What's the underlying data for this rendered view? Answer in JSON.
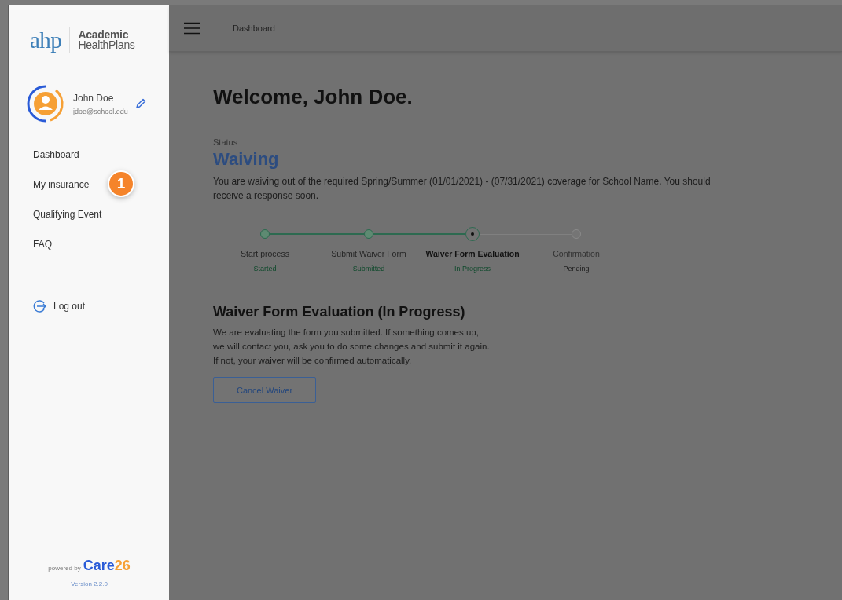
{
  "brand": {
    "mark": "ahp",
    "line_1": "Academic",
    "line_2": "HealthPlans"
  },
  "user": {
    "name": "John Doe",
    "email": "jdoe@school.edu"
  },
  "nav": [
    {
      "label": "Dashboard",
      "selected": false
    },
    {
      "label": "My insurance",
      "selected": false,
      "badge": "1"
    },
    {
      "label": "Qualifying Event",
      "selected": false
    },
    {
      "label": "FAQ",
      "selected": false
    }
  ],
  "logout": "Log out",
  "footer": {
    "powered_by": "powered by",
    "product_a": "Care",
    "product_b": "26",
    "version": "Version 2.2.0"
  },
  "header": {
    "breadcrumb": "Dashboard"
  },
  "welcome": "Welcome, John Doe.",
  "status": {
    "label": "Status",
    "value": "Waiving",
    "message": "You are waiving out of the required Spring/Summer (01/01/2021) - (07/31/2021) coverage for School Name. You should receive a response soon."
  },
  "steps": [
    {
      "title": "Start process",
      "status": "Started",
      "kind": "done"
    },
    {
      "title": "Submit Waiver Form",
      "status": "Submitted",
      "kind": "done"
    },
    {
      "title": "Waiver Form Evaluation",
      "status": "In Progress",
      "kind": "current"
    },
    {
      "title": "Confirmation",
      "status": "Pending",
      "kind": "pending"
    }
  ],
  "section": {
    "title": "Waiver Form Evaluation (In Progress)",
    "text": "We are evaluating the form you submitted. If something comes up,\nwe will contact you, ask you to do some changes and submit it again.\nIf not, your waiver will be confirmed automatically."
  },
  "button": "Cancel Waiver"
}
